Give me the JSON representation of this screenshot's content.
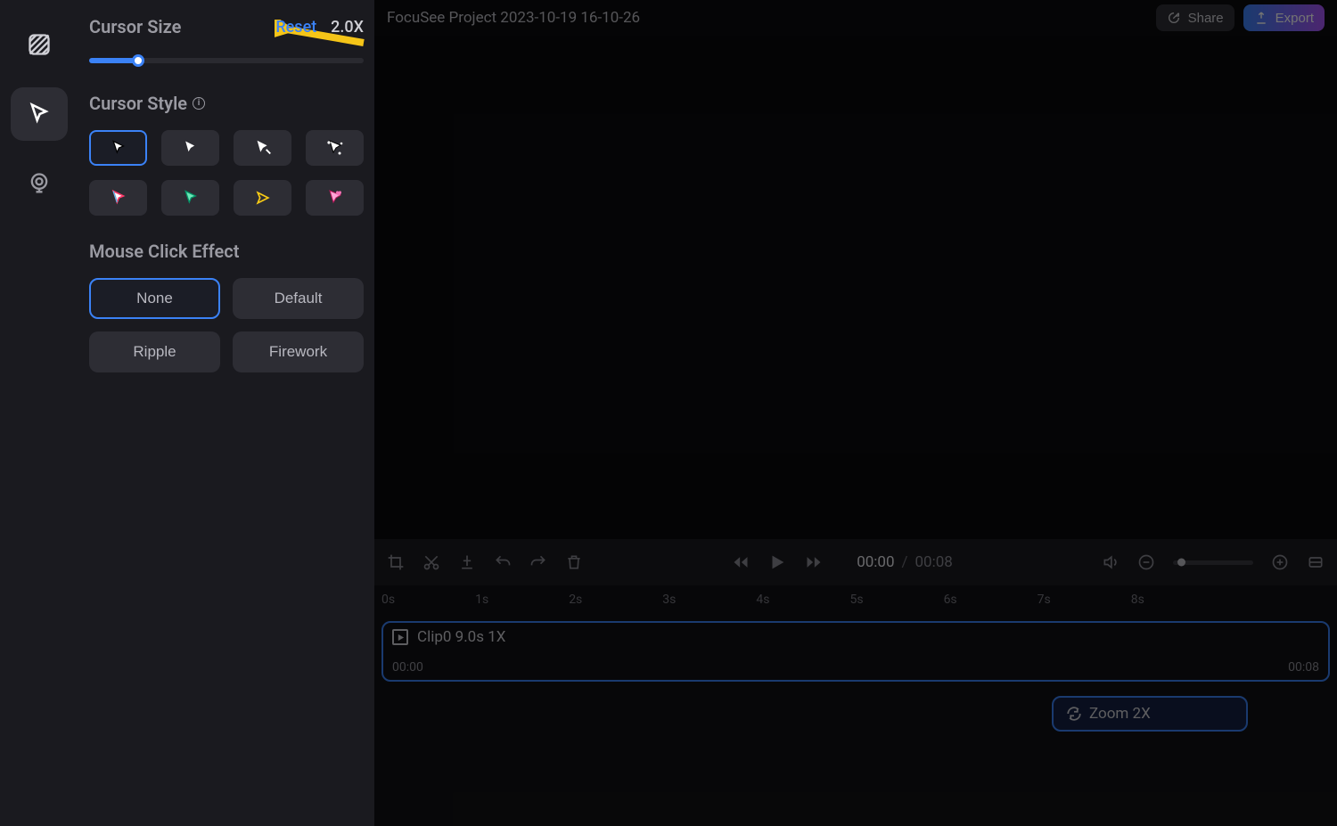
{
  "header": {
    "project_title": "FocuSee Project 2023-10-19 16-10-26",
    "share_label": "Share",
    "export_label": "Export"
  },
  "panel": {
    "cursor_size": {
      "label": "Cursor Size",
      "reset_label": "Reset",
      "value": "2.0X"
    },
    "cursor_style": {
      "label": "Cursor Style"
    },
    "click_effect": {
      "label": "Mouse Click Effect",
      "options": [
        "None",
        "Default",
        "Ripple",
        "Firework"
      ]
    }
  },
  "playback": {
    "current_time": "00:00",
    "total_time": "00:08"
  },
  "timeline": {
    "ticks": [
      "0s",
      "1s",
      "2s",
      "3s",
      "4s",
      "5s",
      "6s",
      "7s",
      "8s"
    ],
    "clip": {
      "label": "Clip0 9.0s 1X",
      "start": "00:00",
      "end": "00:08"
    },
    "zoom_clip": {
      "label": "Zoom 2X"
    }
  },
  "icons": {
    "hatch": "hatch-icon",
    "cursor": "cursor-icon",
    "camera": "camera-icon",
    "share": "share-icon",
    "export": "export-icon",
    "crop": "crop-icon",
    "cut": "cut-icon",
    "marker": "marker-icon",
    "undo": "undo-icon",
    "redo": "redo-icon",
    "trash": "trash-icon",
    "rewind": "rewind-icon",
    "play": "play-icon",
    "ffwd": "ffwd-icon",
    "volume": "volume-icon",
    "zoom_out": "zoom-out-icon",
    "zoom_in": "zoom-in-icon",
    "fit": "fit-icon",
    "refresh": "refresh-icon"
  }
}
